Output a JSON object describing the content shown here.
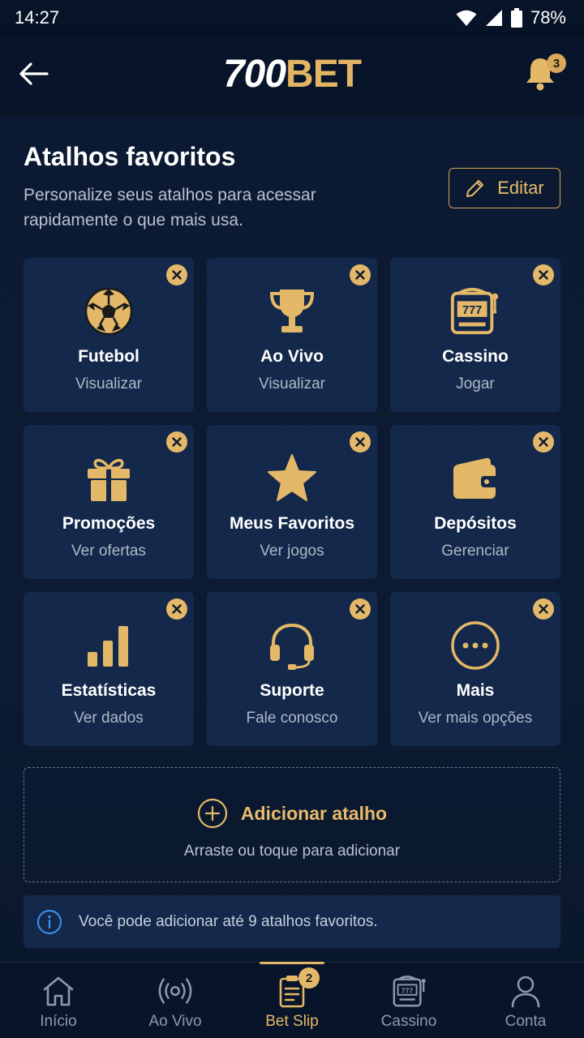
{
  "status_bar": {
    "time": "14:27",
    "battery": "78%"
  },
  "header": {
    "logo_part1": "700",
    "logo_part2": "BET",
    "notifications_count": "3"
  },
  "section": {
    "title": "Atalhos favoritos",
    "subtitle": "Personalize seus atalhos para acessar rapidamente o que mais usa.",
    "edit_label": "Editar"
  },
  "shortcuts": [
    {
      "label": "Futebol",
      "sub": "Visualizar",
      "icon": "soccer-ball-icon"
    },
    {
      "label": "Ao Vivo",
      "sub": "Visualizar",
      "icon": "trophy-icon"
    },
    {
      "label": "Cassino",
      "sub": "Jogar",
      "icon": "slot-machine-icon"
    },
    {
      "label": "Promoções",
      "sub": "Ver ofertas",
      "icon": "gift-icon"
    },
    {
      "label": "Meus Favoritos",
      "sub": "Ver jogos",
      "icon": "star-icon"
    },
    {
      "label": "Depósitos",
      "sub": "Gerenciar",
      "icon": "wallet-icon"
    },
    {
      "label": "Estatísticas",
      "sub": "Ver dados",
      "icon": "bar-chart-icon"
    },
    {
      "label": "Suporte",
      "sub": "Fale conosco",
      "icon": "headset-icon"
    },
    {
      "label": "Mais",
      "sub": "Ver mais opções",
      "icon": "more-icon"
    }
  ],
  "add_shortcut": {
    "label": "Adicionar atalho",
    "sub": "Arraste ou toque para adicionar"
  },
  "info": {
    "text": "Você pode adicionar até 9 atalhos favoritos."
  },
  "bottom_nav": [
    {
      "label": "Início",
      "icon": "home-icon"
    },
    {
      "label": "Ao Vivo",
      "icon": "live-icon"
    },
    {
      "label": "Bet Slip",
      "icon": "betslip-icon",
      "badge": "2",
      "active": true
    },
    {
      "label": "Cassino",
      "icon": "slot-machine-icon"
    },
    {
      "label": "Conta",
      "icon": "user-icon"
    }
  ],
  "colors": {
    "accent": "#e3b868",
    "background": "#0c1a30",
    "tile": "#13284a"
  }
}
